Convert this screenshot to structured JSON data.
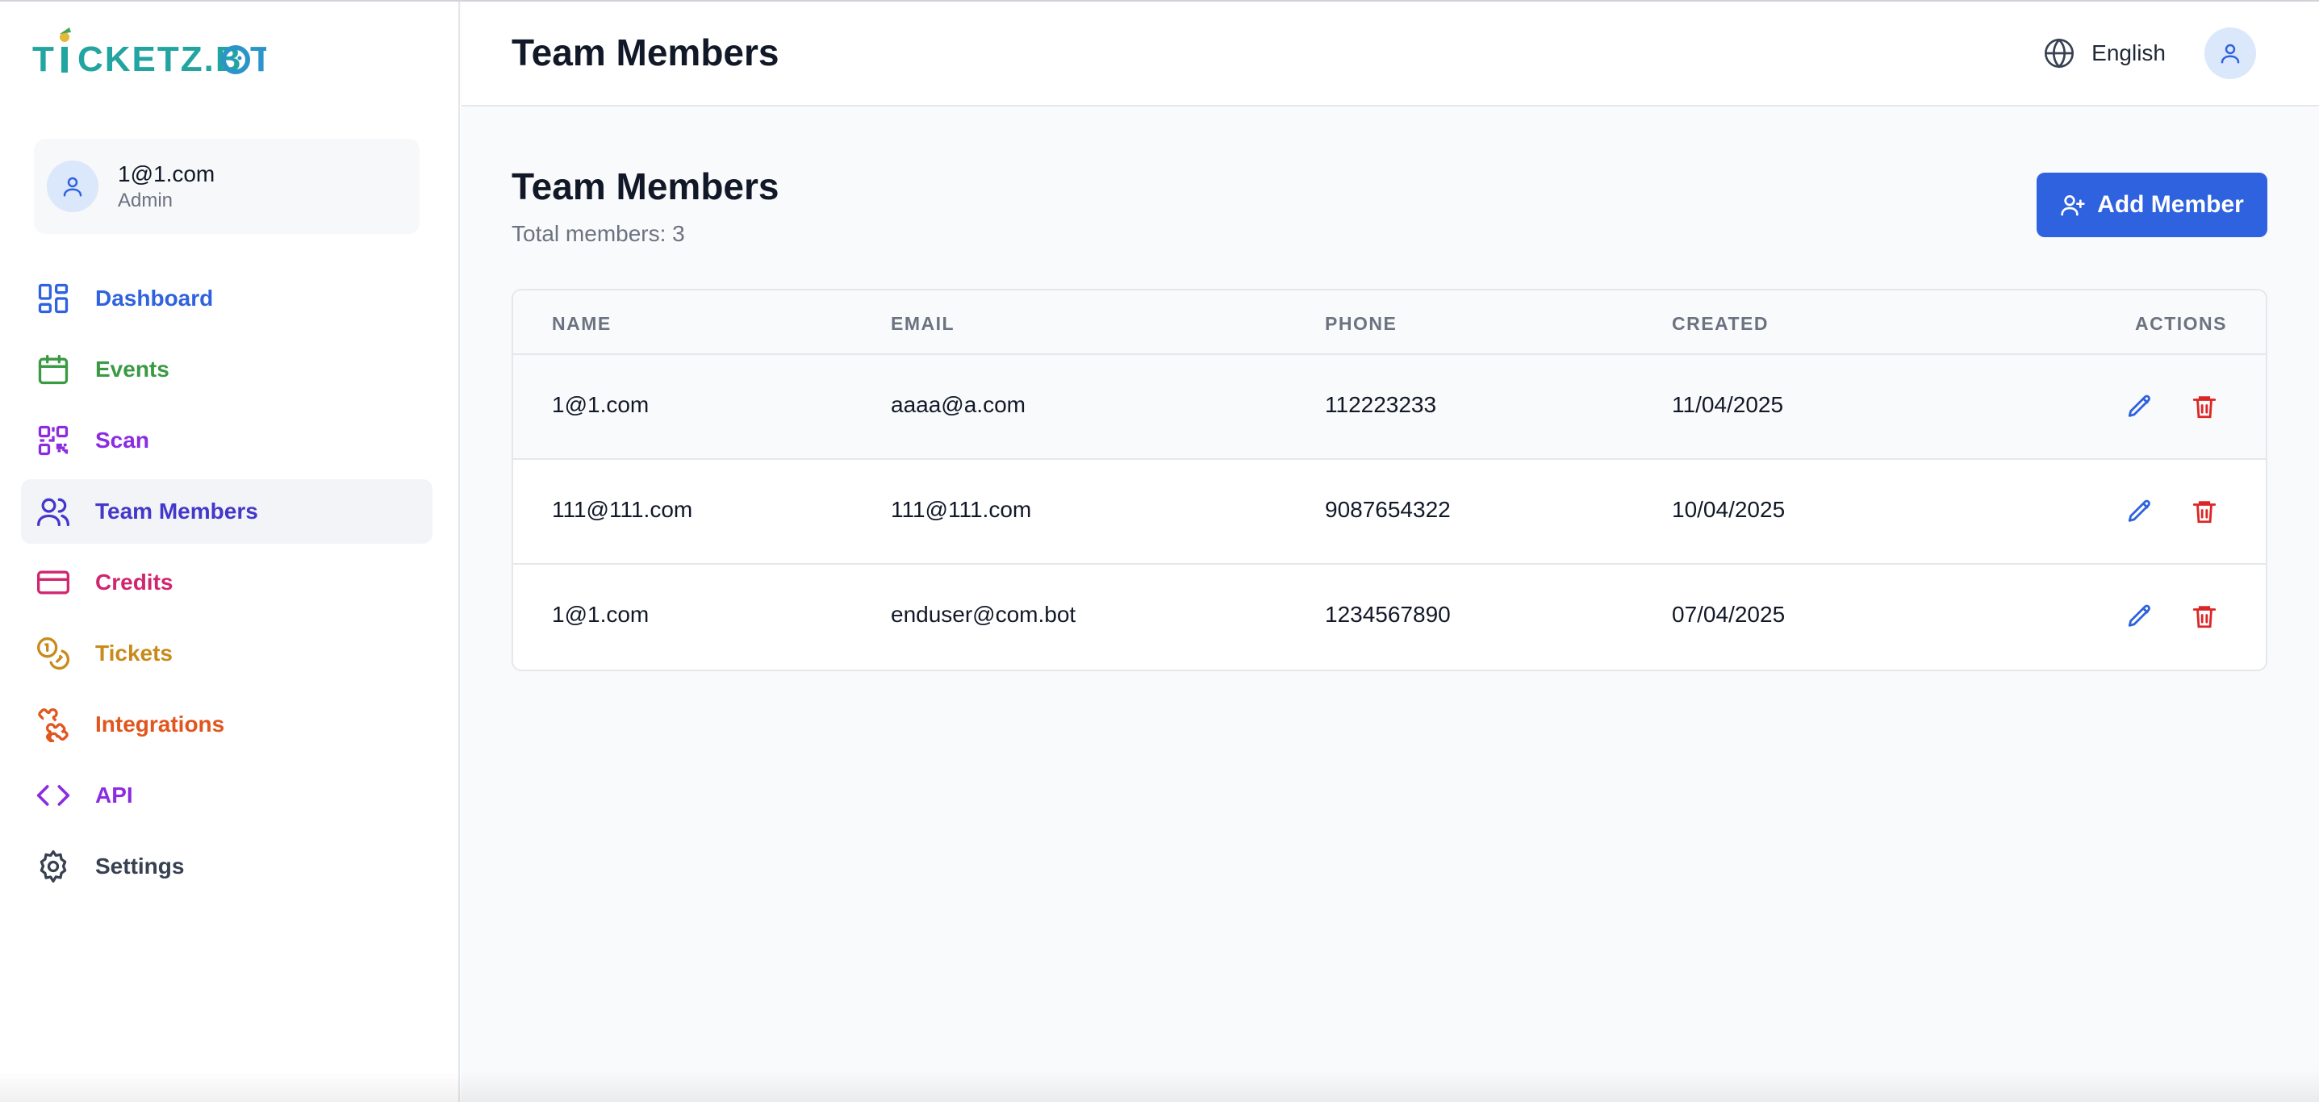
{
  "brand": {
    "logo_text": "TICKETZ.BOT"
  },
  "user": {
    "name": "1@1.com",
    "role": "Admin"
  },
  "nav": [
    {
      "label": "Dashboard",
      "icon": "dashboard-icon",
      "color": "#2f62de"
    },
    {
      "label": "Events",
      "icon": "calendar-icon",
      "color": "#3a9a43"
    },
    {
      "label": "Scan",
      "icon": "qr-code-icon",
      "color": "#8b2be2"
    },
    {
      "label": "Team Members",
      "icon": "users-icon",
      "color": "#4338ca",
      "active": true
    },
    {
      "label": "Credits",
      "icon": "credit-card-icon",
      "color": "#d02670"
    },
    {
      "label": "Tickets",
      "icon": "coins-icon",
      "color": "#c88a1a"
    },
    {
      "label": "Integrations",
      "icon": "puzzle-icon",
      "color": "#e0561e"
    },
    {
      "label": "API",
      "icon": "code-icon",
      "color": "#8b2be2"
    },
    {
      "label": "Settings",
      "icon": "gear-icon",
      "color": "#374151"
    }
  ],
  "header": {
    "title": "Team Members",
    "language": "English"
  },
  "main": {
    "title": "Team Members",
    "subtitle": "Total members: 3",
    "add_button": "Add Member"
  },
  "table": {
    "columns": [
      "NAME",
      "EMAIL",
      "PHONE",
      "CREATED",
      "ACTIONS"
    ],
    "rows": [
      {
        "name": "1@1.com",
        "email": "aaaa@a.com",
        "phone": "112223233",
        "created": "11/04/2025"
      },
      {
        "name": "111@111.com",
        "email": "111@111.com",
        "phone": "9087654322",
        "created": "10/04/2025"
      },
      {
        "name": "1@1.com",
        "email": "enduser@com.bot",
        "phone": "1234567890",
        "created": "07/04/2025"
      }
    ]
  },
  "colors": {
    "primary": "#2f62de",
    "danger": "#dc2626",
    "text": "#111827",
    "muted": "#6b7280"
  }
}
